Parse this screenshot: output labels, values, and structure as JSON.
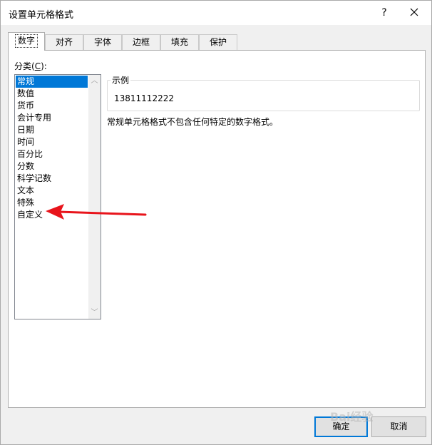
{
  "window": {
    "title": "设置单元格格式",
    "help_label": "?"
  },
  "tabs": [
    {
      "label": "数字",
      "active": true
    },
    {
      "label": "对齐"
    },
    {
      "label": "字体"
    },
    {
      "label": "边框"
    },
    {
      "label": "填充"
    },
    {
      "label": "保护"
    }
  ],
  "category": {
    "label_prefix": "分类(",
    "label_accel": "C",
    "label_suffix": "):",
    "items": [
      "常规",
      "数值",
      "货币",
      "会计专用",
      "日期",
      "时间",
      "百分比",
      "分数",
      "科学记数",
      "文本",
      "特殊",
      "自定义"
    ],
    "selected": "常规"
  },
  "sample": {
    "legend": "示例",
    "value": "13811112222"
  },
  "description": "常规单元格格式不包含任何特定的数字格式。",
  "buttons": {
    "ok": "确定",
    "cancel": "取消"
  },
  "annotation": {
    "arrow_color": "#e8141b"
  },
  "watermark": "Bai经验",
  "colors": {
    "selection": "#0078d7",
    "default_button_border": "#0078d7"
  }
}
